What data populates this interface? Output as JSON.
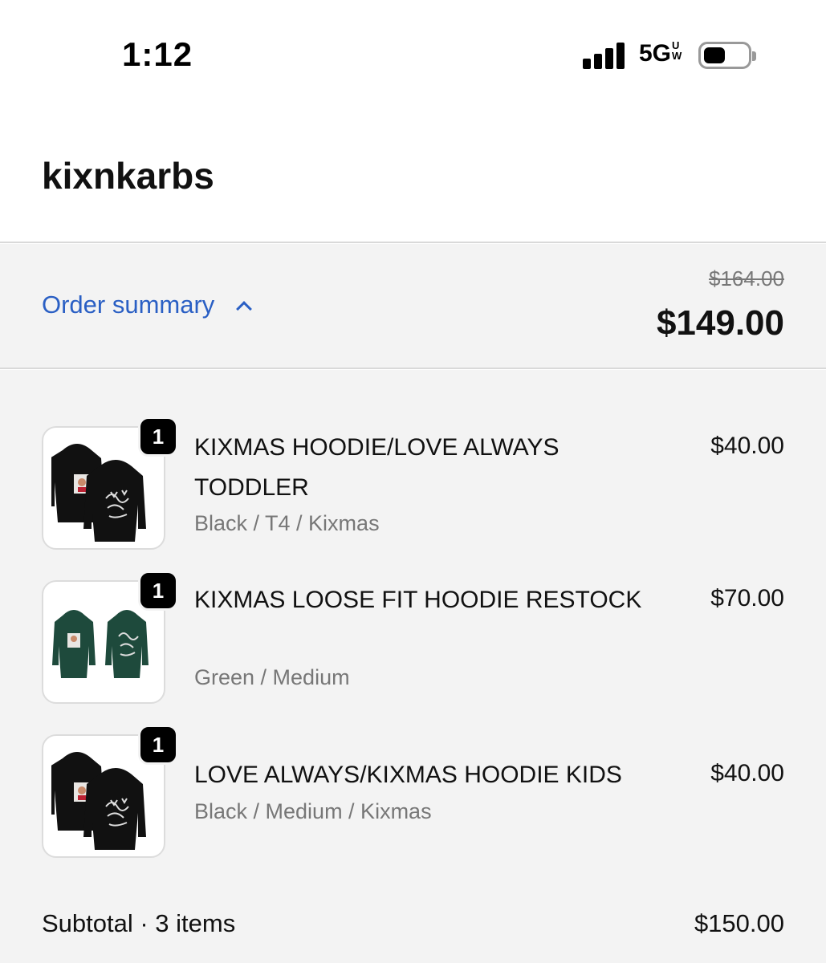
{
  "status_bar": {
    "time": "1:12",
    "network": "5G",
    "network_badge_top": "U",
    "network_badge_bottom": "W",
    "icons": [
      "signal-icon",
      "battery-icon"
    ]
  },
  "store": {
    "name": "kixnkarbs"
  },
  "summary": {
    "toggle_label": "Order summary",
    "original_total": "$164.00",
    "total": "$149.00",
    "accent_color": "#2a5fc4"
  },
  "items": [
    {
      "quantity": "1",
      "name": "KIXMAS HOODIE/LOVE ALWAYS TODDLER",
      "variant": "Black / T4 / Kixmas",
      "price": "$40.00",
      "garment_color": "#111111"
    },
    {
      "quantity": "1",
      "name": "KIXMAS LOOSE FIT HOODIE RESTOCK",
      "variant": "Green / Medium",
      "price": "$70.00",
      "garment_color": "#1e4a3c"
    },
    {
      "quantity": "1",
      "name": "LOVE ALWAYS/KIXMAS HOODIE KIDS",
      "variant": "Black / Medium / Kixmas",
      "price": "$40.00",
      "garment_color": "#111111"
    }
  ],
  "subtotal": {
    "label": "Subtotal · 3 items",
    "value": "$150.00"
  }
}
